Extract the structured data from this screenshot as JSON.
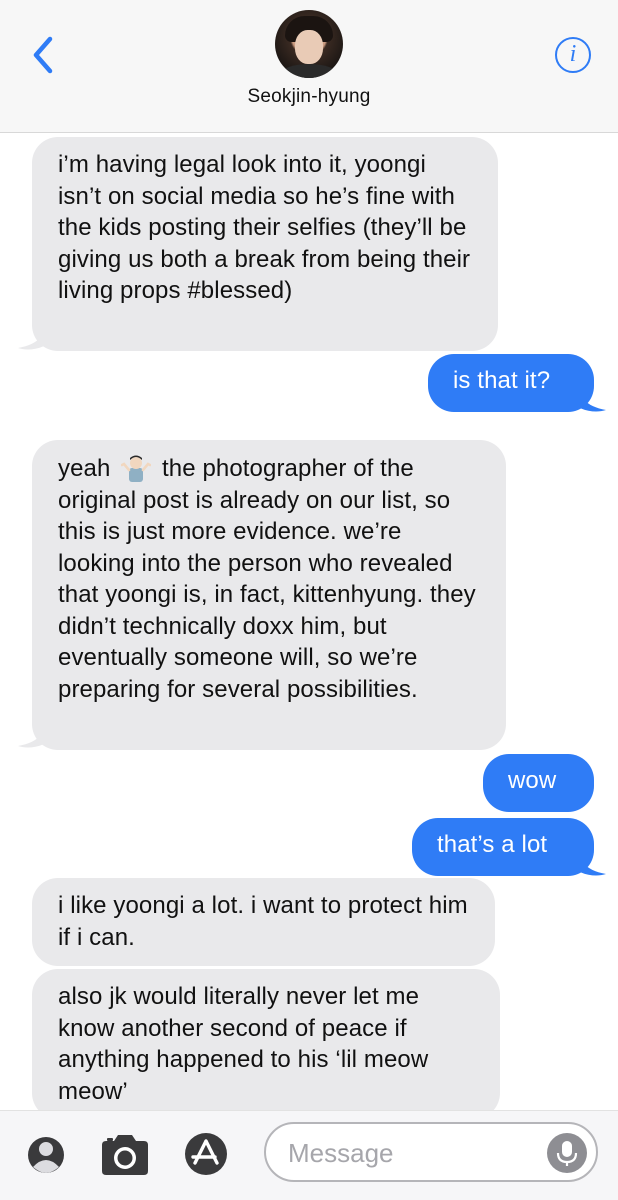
{
  "header": {
    "contact_name": "Seokjin-hyung",
    "info_glyph": "i",
    "back_icon": "chevron-left-icon",
    "accent_color": "#2f7cf6"
  },
  "messages": [
    {
      "direction": "incoming",
      "text": "i’m having legal look into it, yoongi isn’t on social media so he’s fine with the kids posting their selfies (they’ll be giving us both a break from being their living props #blessed)"
    },
    {
      "direction": "outgoing",
      "text": "is that it?"
    },
    {
      "direction": "incoming",
      "text_before": "yeah",
      "emoji": "person-shrugging-emoji",
      "text_after": "the photographer of the original post is already on our list, so this is just more evidence. we’re looking into the person who revealed that yoongi is, in fact, kittenhyung. they didn’t technically doxx him, but eventually someone will, so we’re preparing for several possibilities."
    },
    {
      "direction": "outgoing",
      "text": "wow"
    },
    {
      "direction": "outgoing",
      "text": "that’s a lot"
    },
    {
      "direction": "incoming",
      "text": "i like yoongi a lot. i want to protect him if i can."
    },
    {
      "direction": "incoming",
      "text": "also jk would literally never let me know another second of peace if anything happened to his ‘lil meow meow’"
    }
  ],
  "composer": {
    "placeholder": "Message",
    "value": "",
    "icons": [
      "contact-icon",
      "camera-icon",
      "app-store-icon",
      "microphone-icon"
    ]
  },
  "colors": {
    "incoming_bubble": "#e9e9eb",
    "outgoing_bubble": "#2f7cf6"
  }
}
